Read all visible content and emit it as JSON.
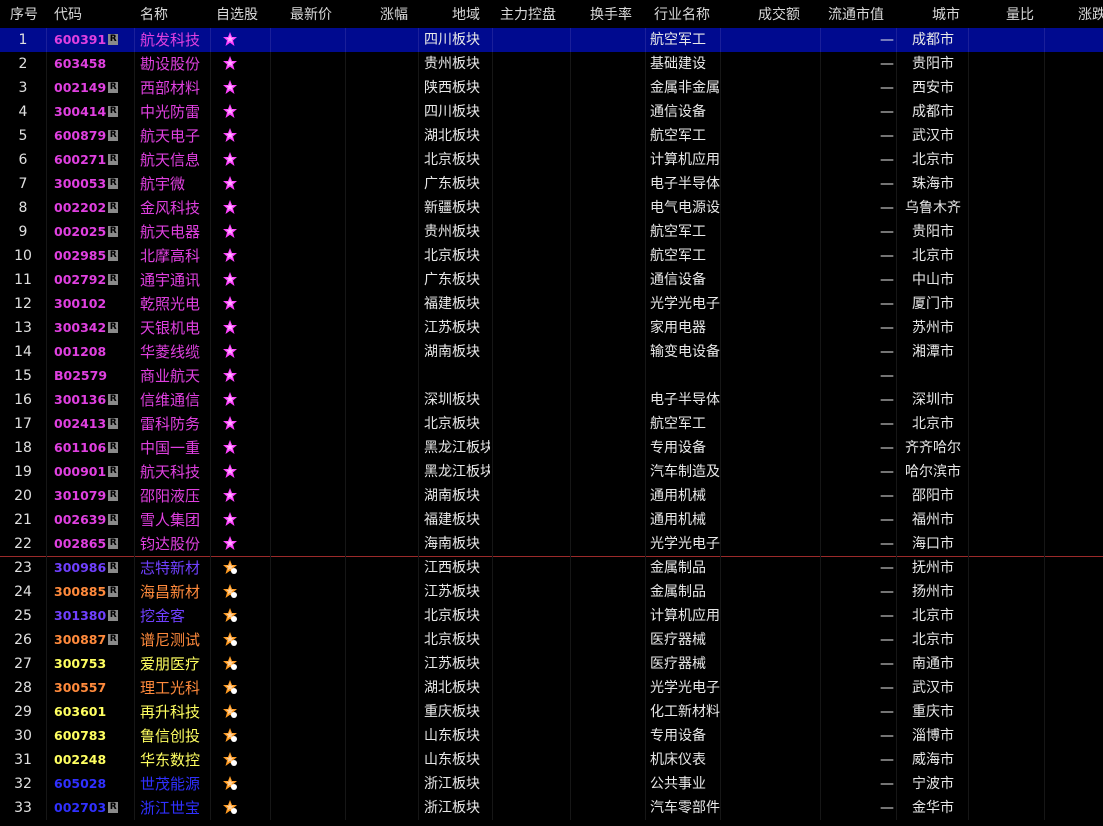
{
  "columns": {
    "seq": "序号",
    "code": "代码",
    "name": "名称",
    "fav": "自选股",
    "latest": "最新价",
    "change_pct": "涨幅",
    "region": "地域",
    "main_control": "主力控盘",
    "turnover": "换手率",
    "industry": "行业名称",
    "amount": "成交额",
    "float_mktcap": "流通市值",
    "city": "城市",
    "vol_ratio": "量比",
    "change_speed": "涨跌"
  },
  "colors": {
    "magenta": "#e040e0",
    "blue_purple": "#7040ff",
    "orange": "#ff8a3c",
    "yellow": "#ffff60",
    "white": "#e8e8e8",
    "blue": "#3030ff",
    "selected_row_bg": "#000a8f",
    "star_magenta": "#ff40ff",
    "star_orange": "#ff9a20"
  },
  "r_badge": "R",
  "rows": [
    {
      "seq": "1",
      "code": "600391",
      "r": true,
      "name": "航发科技",
      "region": "四川板块",
      "industry": "航空军工",
      "mktcap": "—",
      "city": "成都市",
      "color": "magenta",
      "star": "magenta",
      "selected": true
    },
    {
      "seq": "2",
      "code": "603458",
      "r": false,
      "name": "勘设股份",
      "region": "贵州板块",
      "industry": "基础建设",
      "mktcap": "—",
      "city": "贵阳市",
      "color": "magenta",
      "star": "magenta"
    },
    {
      "seq": "3",
      "code": "002149",
      "r": true,
      "name": "西部材料",
      "region": "陕西板块",
      "industry": "金属非金属",
      "mktcap": "—",
      "city": "西安市",
      "color": "magenta",
      "star": "magenta"
    },
    {
      "seq": "4",
      "code": "300414",
      "r": true,
      "name": "中光防雷",
      "region": "四川板块",
      "industry": "通信设备",
      "mktcap": "—",
      "city": "成都市",
      "color": "magenta",
      "star": "magenta"
    },
    {
      "seq": "5",
      "code": "600879",
      "r": true,
      "name": "航天电子",
      "region": "湖北板块",
      "industry": "航空军工",
      "mktcap": "—",
      "city": "武汉市",
      "color": "magenta",
      "star": "magenta"
    },
    {
      "seq": "6",
      "code": "600271",
      "r": true,
      "name": "航天信息",
      "region": "北京板块",
      "industry": "计算机应用",
      "mktcap": "—",
      "city": "北京市",
      "color": "magenta",
      "star": "magenta"
    },
    {
      "seq": "7",
      "code": "300053",
      "r": true,
      "name": "航宇微",
      "region": "广东板块",
      "industry": "电子半导体",
      "mktcap": "—",
      "city": "珠海市",
      "color": "magenta",
      "star": "magenta"
    },
    {
      "seq": "8",
      "code": "002202",
      "r": true,
      "name": "金风科技",
      "region": "新疆板块",
      "industry": "电气电源设备",
      "mktcap": "—",
      "city": "乌鲁木齐",
      "color": "magenta",
      "star": "magenta"
    },
    {
      "seq": "9",
      "code": "002025",
      "r": true,
      "name": "航天电器",
      "region": "贵州板块",
      "industry": "航空军工",
      "mktcap": "—",
      "city": "贵阳市",
      "color": "magenta",
      "star": "magenta"
    },
    {
      "seq": "10",
      "code": "002985",
      "r": true,
      "name": "北摩高科",
      "region": "北京板块",
      "industry": "航空军工",
      "mktcap": "—",
      "city": "北京市",
      "color": "magenta",
      "star": "magenta"
    },
    {
      "seq": "11",
      "code": "002792",
      "r": true,
      "name": "通宇通讯",
      "region": "广东板块",
      "industry": "通信设备",
      "mktcap": "—",
      "city": "中山市",
      "color": "magenta",
      "star": "magenta"
    },
    {
      "seq": "12",
      "code": "300102",
      "r": false,
      "name": "乾照光电",
      "region": "福建板块",
      "industry": "光学光电子",
      "mktcap": "—",
      "city": "厦门市",
      "color": "magenta",
      "star": "magenta"
    },
    {
      "seq": "13",
      "code": "300342",
      "r": true,
      "name": "天银机电",
      "region": "江苏板块",
      "industry": "家用电器",
      "mktcap": "—",
      "city": "苏州市",
      "color": "magenta",
      "star": "magenta"
    },
    {
      "seq": "14",
      "code": "001208",
      "r": false,
      "name": "华菱线缆",
      "region": "湖南板块",
      "industry": "输变电设备",
      "mktcap": "—",
      "city": "湘潭市",
      "color": "magenta",
      "star": "magenta"
    },
    {
      "seq": "15",
      "code": "B02579",
      "r": false,
      "name": "商业航天",
      "region": "",
      "industry": "",
      "mktcap": "—",
      "city": "",
      "color": "magenta",
      "star": "magenta"
    },
    {
      "seq": "16",
      "code": "300136",
      "r": true,
      "name": "信维通信",
      "region": "深圳板块",
      "industry": "电子半导体",
      "mktcap": "—",
      "city": "深圳市",
      "color": "magenta",
      "star": "magenta"
    },
    {
      "seq": "17",
      "code": "002413",
      "r": true,
      "name": "雷科防务",
      "region": "北京板块",
      "industry": "航空军工",
      "mktcap": "—",
      "city": "北京市",
      "color": "magenta",
      "star": "magenta"
    },
    {
      "seq": "18",
      "code": "601106",
      "r": true,
      "name": "中国一重",
      "region": "黑龙江板块",
      "industry": "专用设备",
      "mktcap": "—",
      "city": "齐齐哈尔",
      "color": "magenta",
      "star": "magenta"
    },
    {
      "seq": "19",
      "code": "000901",
      "r": true,
      "name": "航天科技",
      "region": "黑龙江板块",
      "industry": "汽车制造及配件",
      "mktcap": "—",
      "city": "哈尔滨市",
      "color": "magenta",
      "star": "magenta"
    },
    {
      "seq": "20",
      "code": "301079",
      "r": true,
      "name": "邵阳液压",
      "region": "湖南板块",
      "industry": "通用机械",
      "mktcap": "—",
      "city": "邵阳市",
      "color": "magenta",
      "star": "magenta"
    },
    {
      "seq": "21",
      "code": "002639",
      "r": true,
      "name": "雪人集团",
      "region": "福建板块",
      "industry": "通用机械",
      "mktcap": "—",
      "city": "福州市",
      "color": "magenta",
      "star": "magenta"
    },
    {
      "seq": "22",
      "code": "002865",
      "r": true,
      "name": "钧达股份",
      "region": "海南板块",
      "industry": "光学光电子",
      "mktcap": "—",
      "city": "海口市",
      "color": "magenta",
      "star": "magenta"
    },
    {
      "seq": "23",
      "code": "300986",
      "r": true,
      "name": "志特新材",
      "region": "江西板块",
      "industry": "金属制品",
      "mktcap": "—",
      "city": "抚州市",
      "color": "blue_purple",
      "star": "orange"
    },
    {
      "seq": "24",
      "code": "300885",
      "r": true,
      "name": "海昌新材",
      "region": "江苏板块",
      "industry": "金属制品",
      "mktcap": "—",
      "city": "扬州市",
      "color": "orange",
      "star": "orange"
    },
    {
      "seq": "25",
      "code": "301380",
      "r": true,
      "name": "挖金客",
      "region": "北京板块",
      "industry": "计算机应用",
      "mktcap": "—",
      "city": "北京市",
      "color": "blue_purple",
      "star": "orange"
    },
    {
      "seq": "26",
      "code": "300887",
      "r": true,
      "name": "谱尼测试",
      "region": "北京板块",
      "industry": "医疗器械",
      "mktcap": "—",
      "city": "北京市",
      "color": "orange",
      "star": "orange"
    },
    {
      "seq": "27",
      "code": "300753",
      "r": false,
      "name": "爱朋医疗",
      "region": "江苏板块",
      "industry": "医疗器械",
      "mktcap": "—",
      "city": "南通市",
      "color": "yellow",
      "star": "orange"
    },
    {
      "seq": "28",
      "code": "300557",
      "r": false,
      "name": "理工光科",
      "region": "湖北板块",
      "industry": "光学光电子",
      "mktcap": "—",
      "city": "武汉市",
      "color": "orange",
      "star": "orange"
    },
    {
      "seq": "29",
      "code": "603601",
      "r": false,
      "name": "再升科技",
      "region": "重庆板块",
      "industry": "化工新材料",
      "mktcap": "—",
      "city": "重庆市",
      "color": "yellow",
      "star": "orange"
    },
    {
      "seq": "30",
      "code": "600783",
      "r": false,
      "name": "鲁信创投",
      "region": "山东板块",
      "industry": "专用设备",
      "mktcap": "—",
      "city": "淄博市",
      "color": "yellow",
      "star": "orange"
    },
    {
      "seq": "31",
      "code": "002248",
      "r": false,
      "name": "华东数控",
      "region": "山东板块",
      "industry": "机床仪表",
      "mktcap": "—",
      "city": "威海市",
      "color": "yellow",
      "star": "orange"
    },
    {
      "seq": "32",
      "code": "605028",
      "r": false,
      "name": "世茂能源",
      "region": "浙江板块",
      "industry": "公共事业",
      "mktcap": "—",
      "city": "宁波市",
      "color": "blue",
      "star": "orange"
    },
    {
      "seq": "33",
      "code": "002703",
      "r": true,
      "name": "浙江世宝",
      "region": "浙江板块",
      "industry": "汽车零部件",
      "mktcap": "—",
      "city": "金华市",
      "color": "blue",
      "star": "orange"
    }
  ]
}
